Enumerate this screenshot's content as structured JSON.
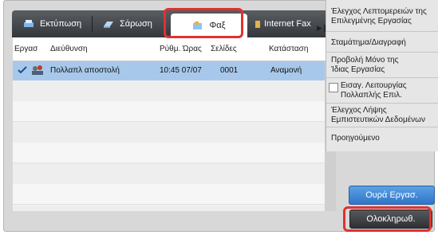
{
  "tabs": {
    "print": "Εκτύπωση",
    "scan": "Σάρωση",
    "fax": "Φαξ",
    "internet_fax": "Internet Fax"
  },
  "table": {
    "headers": {
      "job": "Εργασ",
      "address": "Διεύθυνση",
      "time": "Ρύθμ. Ώρας",
      "pages": "Σελίδες",
      "status": "Κατάσταση"
    },
    "rows": [
      {
        "address": "Πολλαπλ αποστολή",
        "time": "10:45 07/07",
        "pages": "0001",
        "status": "Αναμονή"
      }
    ]
  },
  "menu": {
    "check_details": [
      "Έλεγχος Λεπτομερειών της",
      "Επιλεγμένης Εργασίας"
    ],
    "stop_delete": "Σταμάτημα/Διαγραφή",
    "show_same_job": [
      "Προβολή Μόνο της",
      "Ίδιας Εργασίας"
    ],
    "multi_function": [
      "Εισαγ. Λειτουργίας",
      "Πολλαπλής Επιλ."
    ],
    "check_confidential": [
      "Έλεγχος Λήψης",
      "Εμπιστευτικών Δεδομένων"
    ],
    "previous": "Προηγούμενο"
  },
  "buttons": {
    "job_queue": "Ουρά Εργασ.",
    "complete": "Ολοκληρωθ."
  },
  "icons": {
    "tab_print": "printer-icon",
    "tab_scan": "scanner-icon",
    "tab_fax": "fax-icon",
    "tab_internet_fax": "internet-fax-icon",
    "more": "triangle-right-icon",
    "row_check": "checkmark-icon",
    "row_broadcast": "multiple-recipients-icon"
  },
  "colors": {
    "highlight": "#e0322f",
    "selected_row": "#a7c8ea",
    "queue_button": "#3a85d6",
    "tab_bar": "#3f4246"
  }
}
